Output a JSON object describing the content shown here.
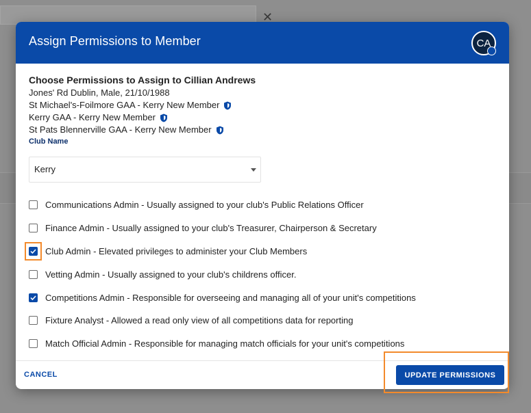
{
  "dialog": {
    "title": "Assign Permissions to Member",
    "avatar_initials": "CA",
    "heading": "Choose Permissions to Assign to Cillian Andrews",
    "member_info": "Jones' Rd Dublin, Male,  21/10/1988",
    "memberships": [
      "St Michael's-Foilmore GAA - Kerry New Member",
      "Kerry GAA - Kerry New Member",
      "St Pats Blennerville GAA - Kerry New Member"
    ],
    "club_name_label": "Club Name",
    "club_select_value": "Kerry",
    "permissions": [
      {
        "label": "Communications Admin - Usually assigned to your club's Public Relations Officer",
        "checked": false
      },
      {
        "label": "Finance Admin - Usually assigned to your club's Treasurer, Chairperson & Secretary",
        "checked": false
      },
      {
        "label": "Club Admin - Elevated privileges to administer your Club Members",
        "checked": true
      },
      {
        "label": "Vetting Admin - Usually assigned to your club's childrens officer.",
        "checked": false
      },
      {
        "label": "Competitions Admin - Responsible for overseeing and managing all of your unit's competitions",
        "checked": true
      },
      {
        "label": "Fixture Analyst - Allowed a read only view of all competitions data for reporting",
        "checked": false
      },
      {
        "label": "Match Official Admin - Responsible for managing match officials for your unit's competitions",
        "checked": false
      }
    ],
    "cancel_label": "CANCEL",
    "update_label": "UPDATE PERMISSIONS"
  },
  "background": {
    "close_glyph": "✕"
  },
  "colors": {
    "primary": "#0a4aa8",
    "highlight": "#f38a2b"
  }
}
